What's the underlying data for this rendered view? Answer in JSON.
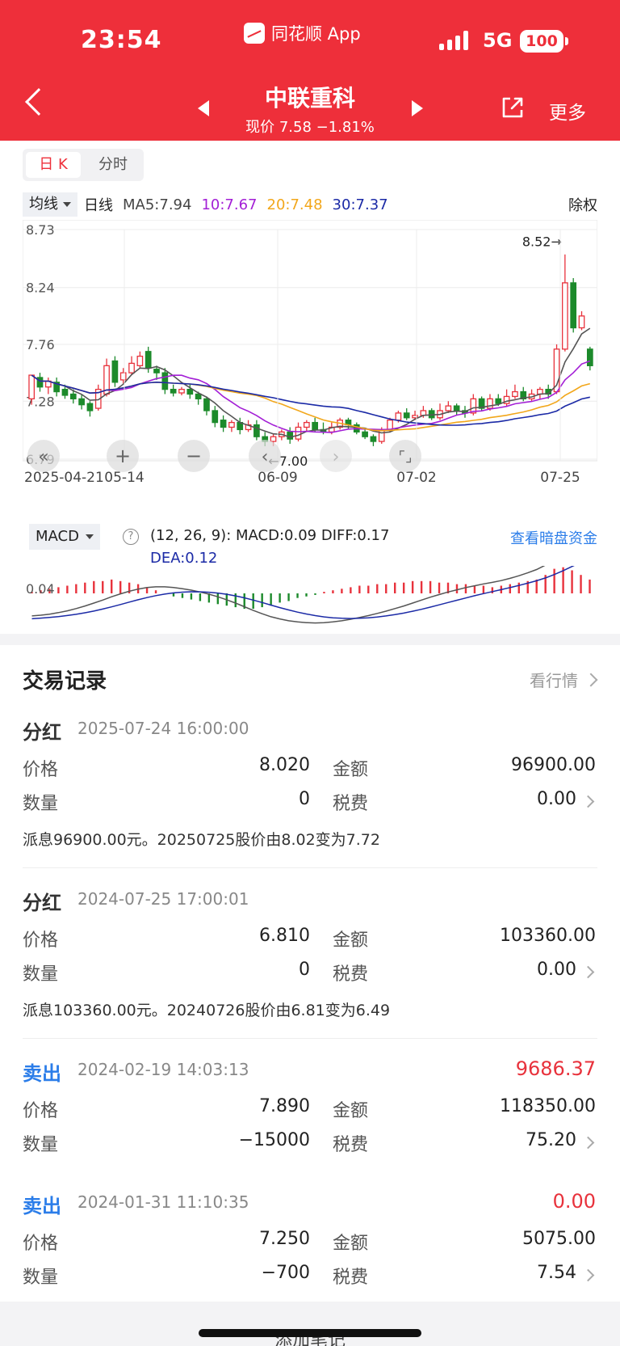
{
  "status": {
    "time": "23:54",
    "app": "同花顺 App",
    "network": "5G",
    "battery": "100"
  },
  "header": {
    "title": "中联重科",
    "price_line": "现价 7.58 −1.81%",
    "more": "更多"
  },
  "tabs": [
    "日 K",
    "分时"
  ],
  "legend": {
    "selector": "均线",
    "period": "日线",
    "ma5": "MA5:7.94",
    "ma10": "10:7.67",
    "ma20": "20:7.48",
    "ma30": "30:7.37",
    "adjust": "除权"
  },
  "colors": {
    "up": "#e8323c",
    "down": "#1c8a2b",
    "ma5": "#555555",
    "ma10": "#a31fd6",
    "ma20": "#f2a71b",
    "ma30": "#1b2aa6",
    "link": "#2b7de9",
    "header": "#ee2f3a"
  },
  "chart_data": [
    {
      "type": "candlestick",
      "title": "",
      "y_ticks": [
        "8.73",
        "8.24",
        "7.76",
        "7.28",
        "6.79"
      ],
      "ylim": [
        6.79,
        8.73
      ],
      "x_ticks": [
        "2025-04-21",
        "05-14",
        "06-09",
        "07-02",
        "07-25"
      ],
      "annotations": {
        "high": "8.52→",
        "low": "←7.00"
      },
      "candles": [
        [
          7.3,
          7.5,
          7.5,
          7.25
        ],
        [
          7.48,
          7.4,
          7.52,
          7.36
        ],
        [
          7.4,
          7.45,
          7.48,
          7.34
        ],
        [
          7.44,
          7.36,
          7.48,
          7.32
        ],
        [
          7.38,
          7.33,
          7.42,
          7.3
        ],
        [
          7.34,
          7.3,
          7.38,
          7.26
        ],
        [
          7.3,
          7.25,
          7.34,
          7.21
        ],
        [
          7.26,
          7.2,
          7.28,
          7.15
        ],
        [
          7.22,
          7.38,
          7.42,
          7.2
        ],
        [
          7.34,
          7.58,
          7.64,
          7.32
        ],
        [
          7.62,
          7.44,
          7.66,
          7.4
        ],
        [
          7.46,
          7.52,
          7.56,
          7.42
        ],
        [
          7.52,
          7.6,
          7.66,
          7.5
        ],
        [
          7.58,
          7.66,
          7.7,
          7.56
        ],
        [
          7.7,
          7.56,
          7.74,
          7.52
        ],
        [
          7.55,
          7.52,
          7.58,
          7.46
        ],
        [
          7.52,
          7.38,
          7.56,
          7.34
        ],
        [
          7.38,
          7.35,
          7.42,
          7.32
        ],
        [
          7.35,
          7.38,
          7.4,
          7.33
        ],
        [
          7.38,
          7.34,
          7.42,
          7.3
        ],
        [
          7.34,
          7.3,
          7.36,
          7.25
        ],
        [
          7.3,
          7.2,
          7.32,
          7.16
        ],
        [
          7.2,
          7.1,
          7.24,
          7.06
        ],
        [
          7.12,
          7.06,
          7.16,
          7.02
        ],
        [
          7.06,
          7.1,
          7.12,
          7.02
        ],
        [
          7.1,
          7.04,
          7.14,
          7.0
        ],
        [
          7.04,
          7.08,
          7.12,
          7.02
        ],
        [
          7.08,
          6.98,
          7.12,
          6.95
        ],
        [
          6.98,
          6.94,
          7.02,
          6.9
        ],
        [
          6.94,
          6.98,
          7.0,
          6.9
        ],
        [
          6.98,
          7.02,
          7.04,
          6.95
        ],
        [
          7.02,
          6.96,
          7.06,
          6.92
        ],
        [
          6.96,
          7.06,
          7.1,
          6.94
        ],
        [
          7.06,
          7.1,
          7.12,
          7.02
        ],
        [
          7.1,
          7.04,
          7.14,
          7.02
        ],
        [
          7.04,
          7.02,
          7.1,
          7.0
        ],
        [
          7.02,
          7.06,
          7.1,
          7.0
        ],
        [
          7.06,
          7.12,
          7.14,
          7.04
        ],
        [
          7.12,
          7.08,
          7.14,
          7.04
        ],
        [
          7.08,
          7.02,
          7.1,
          7.0
        ],
        [
          7.02,
          6.98,
          7.04,
          6.96
        ],
        [
          6.98,
          6.94,
          7.0,
          6.9
        ],
        [
          6.94,
          7.04,
          7.06,
          6.92
        ],
        [
          7.04,
          7.12,
          7.14,
          7.02
        ],
        [
          7.12,
          7.18,
          7.2,
          7.1
        ],
        [
          7.18,
          7.14,
          7.22,
          7.12
        ],
        [
          7.14,
          7.16,
          7.2,
          7.12
        ],
        [
          7.16,
          7.2,
          7.24,
          7.14
        ],
        [
          7.2,
          7.14,
          7.22,
          7.12
        ],
        [
          7.14,
          7.2,
          7.26,
          7.12
        ],
        [
          7.2,
          7.24,
          7.28,
          7.18
        ],
        [
          7.24,
          7.2,
          7.26,
          7.16
        ],
        [
          7.2,
          7.18,
          7.24,
          7.14
        ],
        [
          7.18,
          7.3,
          7.34,
          7.16
        ],
        [
          7.3,
          7.22,
          7.32,
          7.2
        ],
        [
          7.22,
          7.3,
          7.34,
          7.2
        ],
        [
          7.3,
          7.26,
          7.34,
          7.24
        ],
        [
          7.26,
          7.32,
          7.38,
          7.24
        ],
        [
          7.32,
          7.36,
          7.42,
          7.3
        ],
        [
          7.36,
          7.3,
          7.4,
          7.28
        ],
        [
          7.3,
          7.34,
          7.38,
          7.28
        ],
        [
          7.34,
          7.38,
          7.4,
          7.3
        ],
        [
          7.38,
          7.34,
          7.42,
          7.3
        ],
        [
          7.36,
          7.72,
          7.76,
          7.34
        ],
        [
          7.72,
          8.28,
          8.52,
          7.7
        ],
        [
          8.28,
          7.9,
          8.32,
          7.86
        ],
        [
          7.9,
          8.0,
          8.04,
          7.88
        ],
        [
          7.72,
          7.58,
          7.74,
          7.54
        ]
      ]
    },
    {
      "type": "bar",
      "title": "",
      "indicator": "MACD",
      "params": "(12, 26, 9):",
      "macd": "MACD:0.09",
      "diff": "DIFF:0.17",
      "dea": "DEA:0.12",
      "y_tick": "0.04",
      "link": "查看暗盘资金",
      "values": [
        0.01,
        0.02,
        0.03,
        0.04,
        0.05,
        0.06,
        0.07,
        0.08,
        0.08,
        0.09,
        0.08,
        0.07,
        0.06,
        0.04,
        0.02,
        0.0,
        -0.02,
        -0.03,
        -0.04,
        -0.05,
        -0.06,
        -0.07,
        -0.08,
        -0.09,
        -0.1,
        -0.1,
        -0.09,
        -0.08,
        -0.06,
        -0.05,
        -0.03,
        -0.02,
        -0.01,
        0.01,
        0.02,
        0.03,
        0.04,
        0.05,
        0.05,
        0.06,
        0.06,
        0.07,
        0.07,
        0.08,
        0.08,
        0.08,
        0.07,
        0.07,
        0.06,
        0.06,
        0.05,
        0.05,
        0.04,
        0.05,
        0.06,
        0.07,
        0.08,
        0.09,
        0.12,
        0.16,
        0.17,
        0.15,
        0.12,
        0.09
      ]
    }
  ],
  "records": {
    "title": "交易记录",
    "link": "看行情",
    "items": [
      {
        "type": "分红",
        "datetime": "2025-07-24 16:00:00",
        "amount": "",
        "price_label": "价格",
        "price": "8.020",
        "total_label": "金额",
        "total": "96900.00",
        "qty_label": "数量",
        "qty": "0",
        "fee_label": "税费",
        "fee": "0.00",
        "note": "派息96900.00元。20250725股价由8.02变为7.72"
      },
      {
        "type": "分红",
        "datetime": "2024-07-25 17:00:01",
        "amount": "",
        "price_label": "价格",
        "price": "6.810",
        "total_label": "金额",
        "total": "103360.00",
        "qty_label": "数量",
        "qty": "0",
        "fee_label": "税费",
        "fee": "0.00",
        "note": "派息103360.00元。20240726股价由6.81变为6.49"
      },
      {
        "type": "卖出",
        "datetime": "2024-02-19 14:03:13",
        "amount": "9686.37",
        "price_label": "价格",
        "price": "7.890",
        "total_label": "金额",
        "total": "118350.00",
        "qty_label": "数量",
        "qty": "−15000",
        "fee_label": "税费",
        "fee": "75.20",
        "note": ""
      },
      {
        "type": "卖出",
        "datetime": "2024-01-31 11:10:35",
        "amount": "0.00",
        "price_label": "价格",
        "price": "7.250",
        "total_label": "金额",
        "total": "5075.00",
        "qty_label": "数量",
        "qty": "−700",
        "fee_label": "税费",
        "fee": "7.54",
        "note": ""
      }
    ]
  },
  "footer": {
    "add_note": "添加笔记"
  }
}
